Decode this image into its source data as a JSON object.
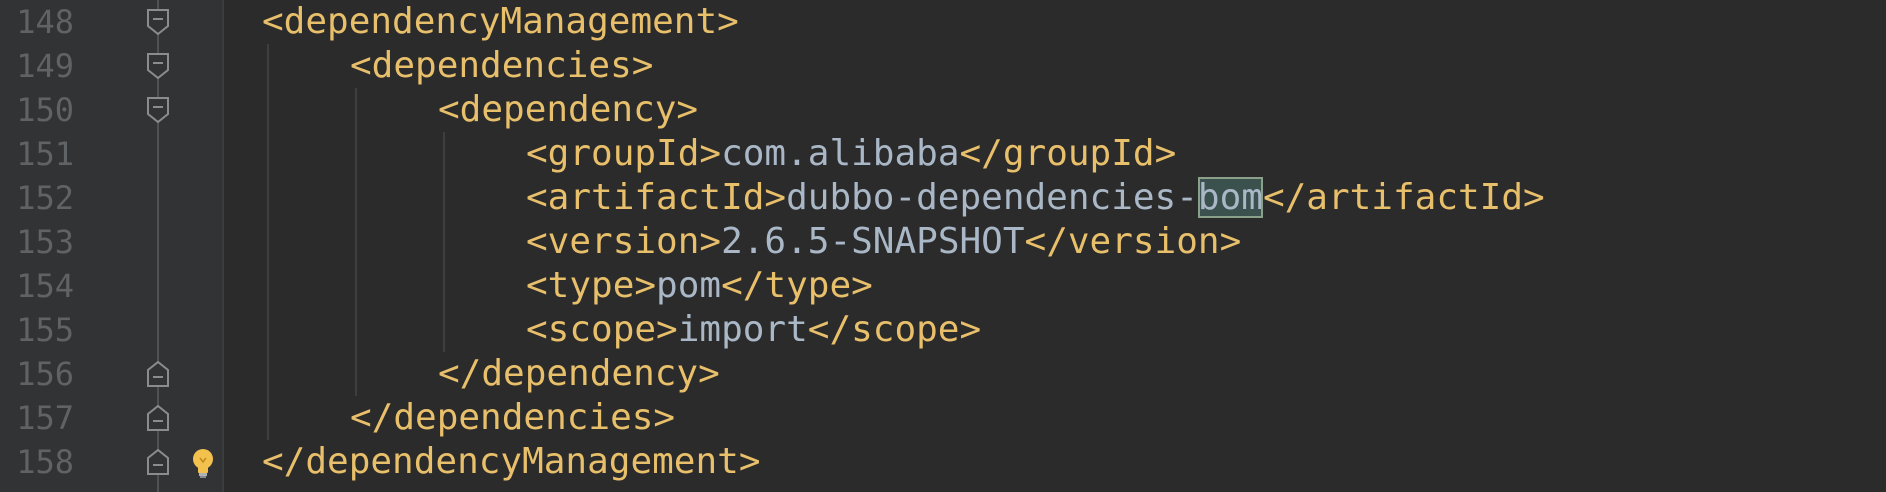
{
  "editor": {
    "lines": [
      {
        "number": "148",
        "tag_open": "<dependencyManagement>",
        "fold": "open"
      },
      {
        "number": "149",
        "tag_open": "<dependencies>",
        "fold": "open"
      },
      {
        "number": "150",
        "tag_open": "<dependency>",
        "fold": "open"
      },
      {
        "number": "151",
        "tag_open": "<groupId>",
        "text": "com.alibaba",
        "tag_close": "</groupId>"
      },
      {
        "number": "152",
        "tag_open": "<artifactId>",
        "text": "dubbo-dependencies-",
        "highlight": "bom",
        "tag_close": "</artifactId>"
      },
      {
        "number": "153",
        "tag_open": "<version>",
        "text": "2.6.5-SNAPSHOT",
        "tag_close": "</version>"
      },
      {
        "number": "154",
        "tag_open": "<type>",
        "text": "pom",
        "tag_close": "</type>"
      },
      {
        "number": "155",
        "tag_open": "<scope>",
        "text": "import",
        "tag_close": "</scope>"
      },
      {
        "number": "156",
        "tag_close": "</dependency>",
        "fold": "close"
      },
      {
        "number": "157",
        "tag_close": "</dependencies>",
        "fold": "close"
      },
      {
        "number": "158",
        "tag_close": "</dependencyManagement>",
        "fold": "close",
        "intention": "lightbulb-icon"
      }
    ]
  },
  "colors": {
    "background": "#2b2b2b",
    "gutter": "#313335",
    "line_number": "#606366",
    "tag": "#e8bf6a",
    "text": "#a9b7c6",
    "highlight_bg": "#3b514d"
  }
}
